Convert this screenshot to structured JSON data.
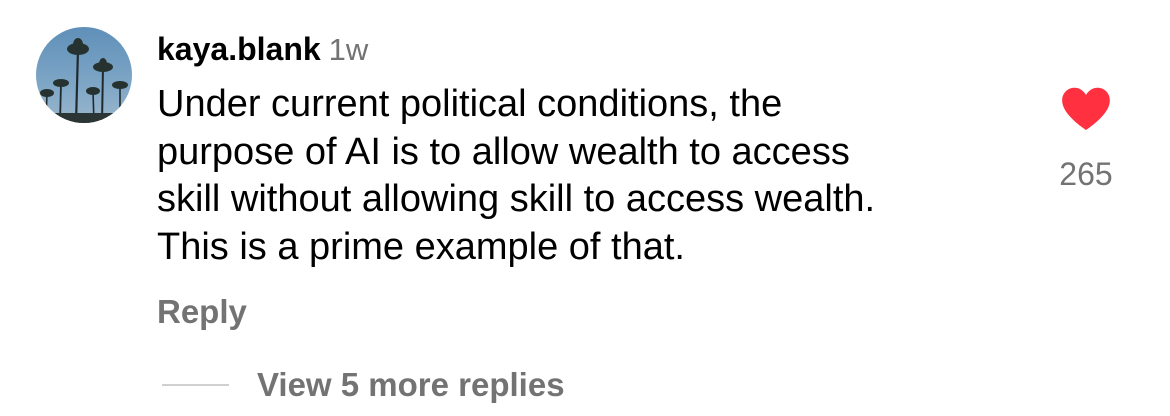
{
  "comment": {
    "username": "kaya.blank",
    "timestamp": "1w",
    "lines": [
      "Under current political conditions, the",
      "purpose of AI is to allow wealth to access",
      "skill without allowing skill to access wealth.",
      "This is a prime example of that."
    ],
    "reply_label": "Reply",
    "like_count": "265",
    "like_icon": "heart-filled-icon",
    "like_color": "#ff3040"
  },
  "thread": {
    "more_replies_label": "View 5 more replies"
  },
  "colors": {
    "text_primary": "#000000",
    "text_secondary": "#737373",
    "divider": "#d0d0d0"
  }
}
